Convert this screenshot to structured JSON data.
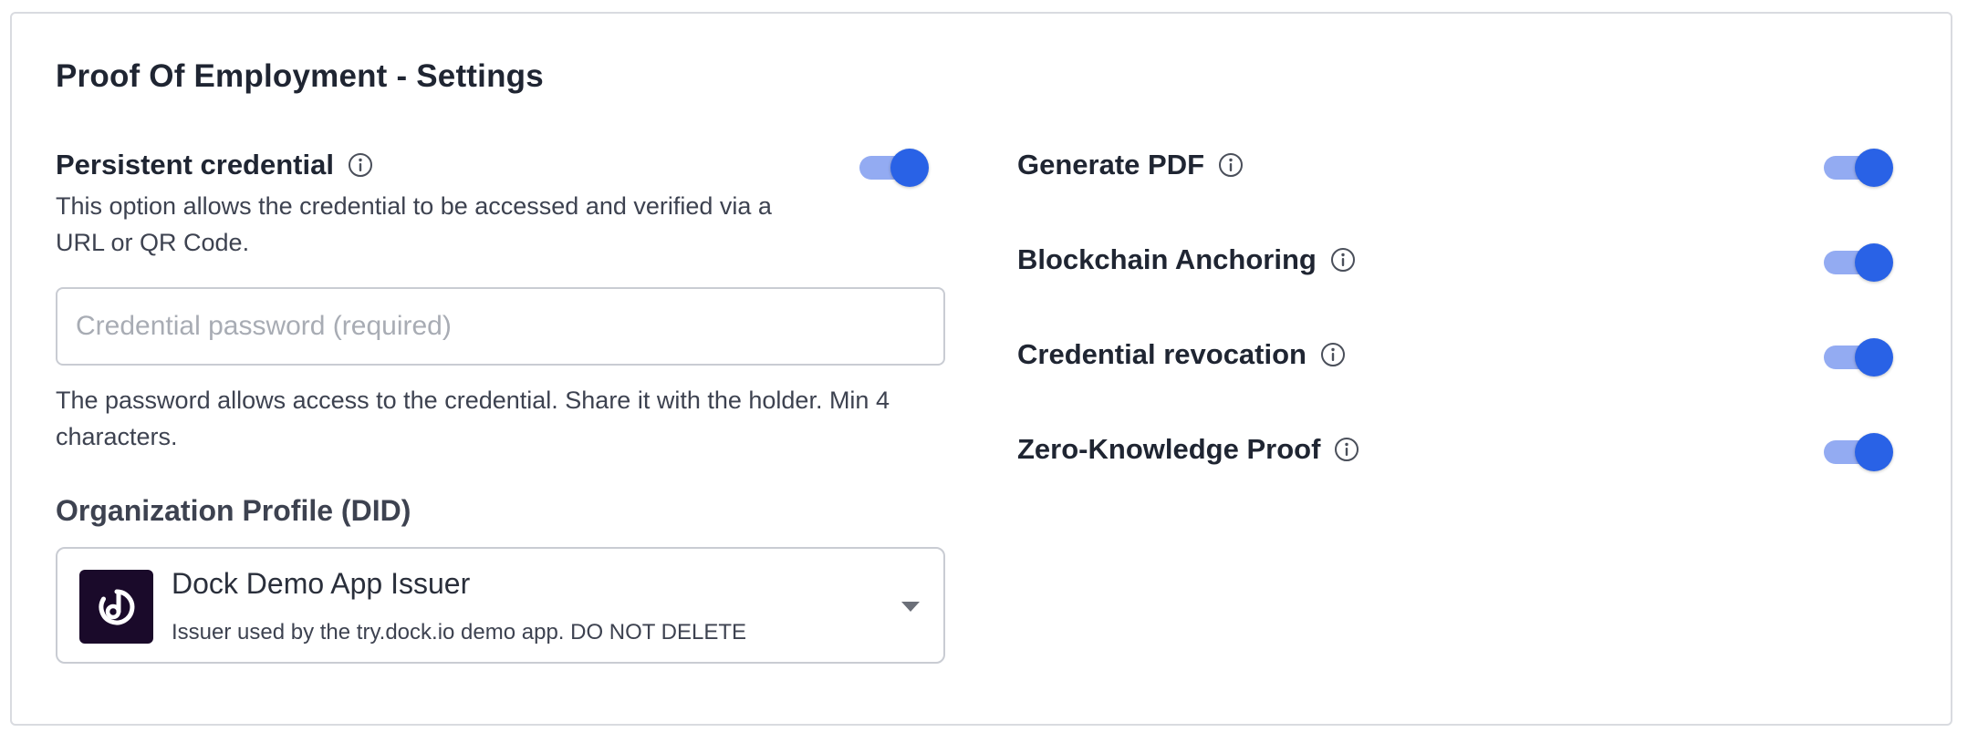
{
  "settings": {
    "title": "Proof Of Employment - Settings",
    "persistent": {
      "label": "Persistent credential",
      "description": "This option allows the credential to be accessed and verified via a URL or QR Code.",
      "enabled": true
    },
    "password": {
      "placeholder": "Credential password (required)",
      "value": "",
      "help": "The password allows access to the credential. Share it with the holder. Min 4 characters."
    },
    "organization": {
      "label": "Organization Profile (DID)",
      "selected_name": "Dock Demo App Issuer",
      "selected_description": "Issuer used by the try.dock.io demo app. DO NOT DELETE"
    },
    "options": [
      {
        "label": "Generate PDF",
        "enabled": true
      },
      {
        "label": "Blockchain Anchoring",
        "enabled": true
      },
      {
        "label": "Credential revocation",
        "enabled": true
      },
      {
        "label": "Zero-Knowledge Proof",
        "enabled": true
      }
    ]
  },
  "icons": {
    "info": "info-circle-icon",
    "caret": "caret-down-icon",
    "org_logo": "dock-logo-icon"
  },
  "colors": {
    "toggle_knob": "#2962e6",
    "toggle_track": "#93abf2",
    "text_primary": "#1f2532",
    "border": "#d9dbe0",
    "org_logo_bg": "#1a0a2a"
  }
}
